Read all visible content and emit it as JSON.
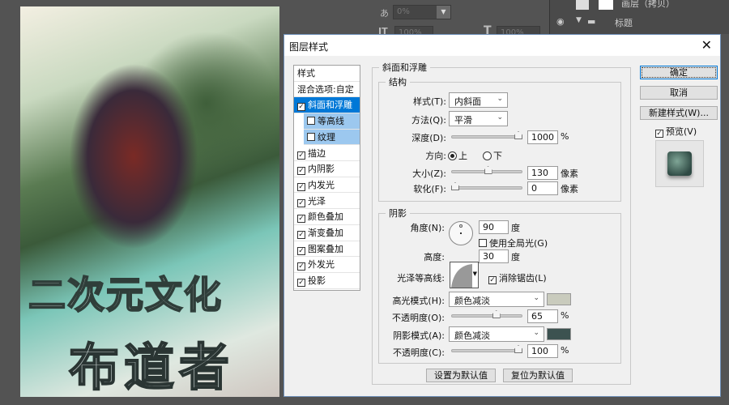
{
  "artwork": {
    "title_line1": "二次元文化",
    "title_line2": "布道者"
  },
  "background_panel": {
    "tracking_value": "0%",
    "scale_v": "100%",
    "scale_h": "100%",
    "layer_name_partial": "画层（拷贝）",
    "group_name": "标题"
  },
  "dialog": {
    "title": "图层样式",
    "close_icon": "close-icon",
    "styles_list": [
      {
        "label": "样式",
        "type": "header"
      },
      {
        "label": "混合选项:自定",
        "type": "header"
      },
      {
        "label": "斜面和浮雕",
        "checked": true,
        "selected": true
      },
      {
        "label": "等高线",
        "checked": false,
        "sub": true
      },
      {
        "label": "纹理",
        "checked": false,
        "sub": true
      },
      {
        "label": "描边",
        "checked": true
      },
      {
        "label": "内阴影",
        "checked": true
      },
      {
        "label": "内发光",
        "checked": true
      },
      {
        "label": "光泽",
        "checked": true
      },
      {
        "label": "颜色叠加",
        "checked": true
      },
      {
        "label": "渐变叠加",
        "checked": true
      },
      {
        "label": "图案叠加",
        "checked": true
      },
      {
        "label": "外发光",
        "checked": true
      },
      {
        "label": "投影",
        "checked": true
      }
    ],
    "bevel": {
      "group_title": "斜面和浮雕",
      "structure": {
        "title": "结构",
        "style_label": "样式(T):",
        "style_value": "内斜面",
        "technique_label": "方法(Q):",
        "technique_value": "平滑",
        "depth_label": "深度(D):",
        "depth_value": "1000",
        "depth_unit": "%",
        "depth_slider": 1.0,
        "direction_label": "方向:",
        "direction_up": "上",
        "direction_down": "下",
        "direction_selected": "上",
        "size_label": "大小(Z):",
        "size_value": "130",
        "size_unit": "像素",
        "size_slider": 0.52,
        "soften_label": "软化(F):",
        "soften_value": "0",
        "soften_unit": "像素",
        "soften_slider": 0.0
      },
      "shading": {
        "title": "阴影",
        "angle_label": "角度(N):",
        "angle_value": "90",
        "angle_unit": "度",
        "global_light_label": "使用全局光(G)",
        "global_light_checked": false,
        "altitude_label": "高度:",
        "altitude_value": "30",
        "altitude_unit": "度",
        "gloss_contour_label": "光泽等高线:",
        "anti_alias_label": "消除锯齿(L)",
        "anti_alias_checked": true,
        "highlight_mode_label": "高光模式(H):",
        "highlight_mode_value": "颜色减淡",
        "highlight_color": "#c9cbbd",
        "highlight_opacity_label": "不透明度(O):",
        "highlight_opacity_value": "65",
        "highlight_opacity_unit": "%",
        "highlight_opacity_slider": 0.65,
        "shadow_mode_label": "阴影模式(A):",
        "shadow_mode_value": "颜色减淡",
        "shadow_color": "#3c5250",
        "shadow_opacity_label": "不透明度(C):",
        "shadow_opacity_value": "100",
        "shadow_opacity_unit": "%",
        "shadow_opacity_slider": 1.0
      },
      "make_default": "设置为默认值",
      "reset_default": "复位为默认值"
    },
    "buttons": {
      "ok": "确定",
      "cancel": "取消",
      "new_style": "新建样式(W)...",
      "preview_label": "预览(V)",
      "preview_checked": true
    }
  }
}
